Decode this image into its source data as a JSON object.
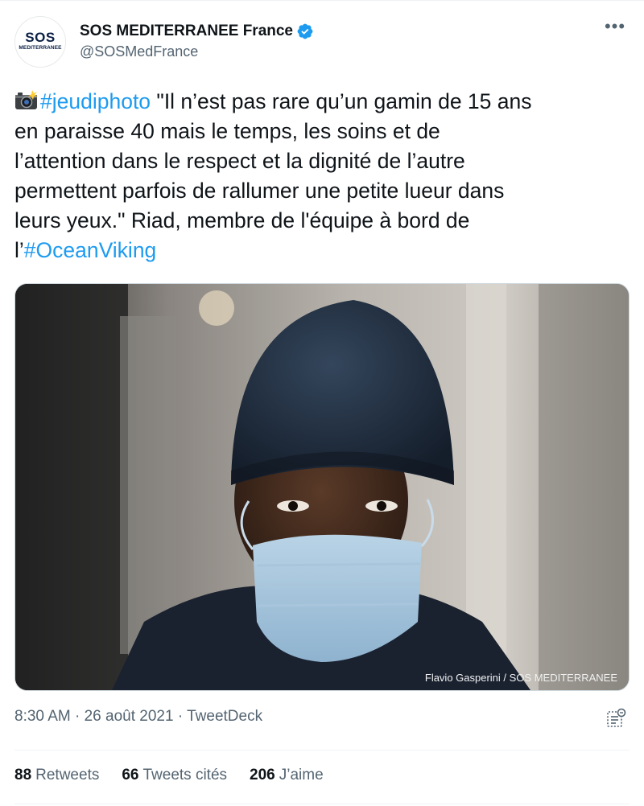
{
  "account": {
    "avatar_logo_main": "SOS",
    "avatar_logo_sub": "MEDITERRANEE",
    "display_name": "SOS MEDITERRANEE France",
    "handle": "@SOSMedFrance",
    "verified": true
  },
  "menu": {
    "more_icon": "more-icon"
  },
  "tweet": {
    "emoji": "camera-flash-icon",
    "hashtag1": "#jeudiphoto",
    "text_part1": " \"Il n’est pas rare qu’un gamin de 15 ans\nen paraisse 40 mais le temps, les soins et de\nl’attention dans le respect et la dignité de l’autre\npermettent parfois de rallumer une petite lueur dans\nleurs yeux.\" Riad, membre de l'équipe à bord de\nl’",
    "hashtag2": "#OceanViking"
  },
  "media": {
    "photo_credit": "Flavio Gasperini / SOS MEDITERRANEE"
  },
  "meta": {
    "time": "8:30 AM",
    "date": "26 août 2021",
    "source": "TweetDeck",
    "separator": " · "
  },
  "stats": {
    "retweets_count": "88",
    "retweets_label": "Retweets",
    "quotes_count": "66",
    "quotes_label": "Tweets cités",
    "likes_count": "206",
    "likes_label": "J’aime"
  },
  "colors": {
    "link": "#1d9bf0",
    "verified": "#1d9bf0",
    "secondary_text": "#536471",
    "primary_text": "#0f1419"
  }
}
